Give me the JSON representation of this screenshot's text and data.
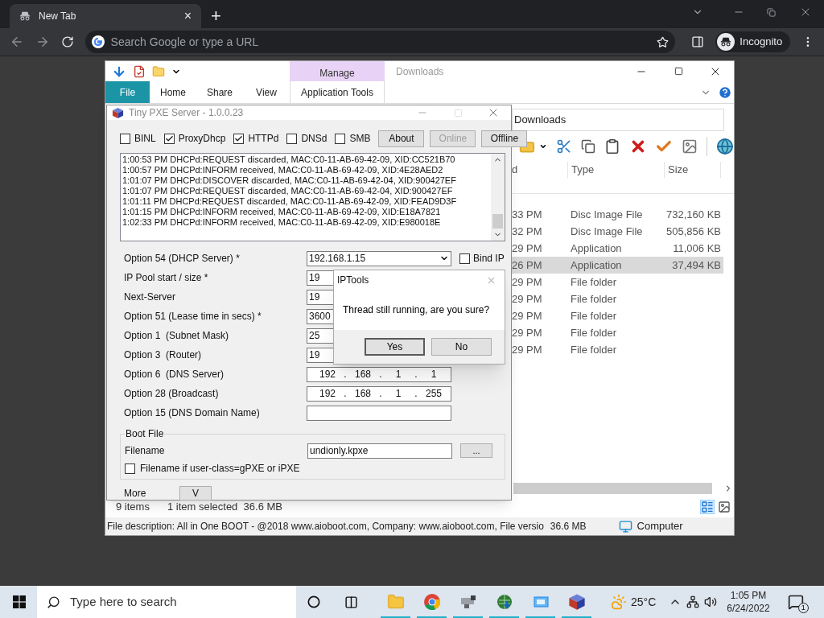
{
  "browser": {
    "tab": {
      "title": "New Tab",
      "close": "×"
    },
    "new_tab": "+",
    "omnibox": {
      "placeholder": "Search Google or type a URL"
    },
    "profile": "Incognito"
  },
  "explorer": {
    "contextual_header": "Manage",
    "title": "Downloads",
    "ribbon_tabs": [
      {
        "label": "File",
        "kind": "file",
        "selected": false
      },
      {
        "label": "Home",
        "kind": "tab",
        "selected": false
      },
      {
        "label": "Share",
        "kind": "tab",
        "selected": false
      },
      {
        "label": "View",
        "kind": "tab",
        "selected": false
      },
      {
        "label": "Application Tools",
        "kind": "contextual",
        "selected": false
      }
    ],
    "address": "Downloads",
    "columns": [
      "d",
      "Type",
      "Size"
    ],
    "rows": [
      {
        "date": "33 PM",
        "type": "Disc Image File",
        "size": "732,160 KB",
        "selected": false
      },
      {
        "date": "32 PM",
        "type": "Disc Image File",
        "size": "505,856 KB",
        "selected": false
      },
      {
        "date": "29 PM",
        "type": "Application",
        "size": "11,006 KB",
        "selected": false
      },
      {
        "date": "26 PM",
        "type": "Application",
        "size": "37,494 KB",
        "selected": true
      },
      {
        "date": "29 PM",
        "type": "File folder",
        "selected": false
      },
      {
        "date": "29 PM",
        "type": "File folder",
        "selected": false
      },
      {
        "date": "29 PM",
        "type": "File folder",
        "selected": false
      },
      {
        "date": "29 PM",
        "type": "File folder",
        "selected": false
      },
      {
        "date": "29 PM",
        "type": "File folder",
        "selected": false
      }
    ],
    "status": {
      "items": "9 items",
      "selection": "1 item selected  36.6 MB"
    },
    "details_bar": {
      "description": "File description: All in One BOOT - @2018 www.aioboot.com, Company: www.aioboot.com, File versio",
      "size": "36.6 MB",
      "location": "Computer"
    }
  },
  "pxe": {
    "title": "Tiny PXE Server - 1.0.0.23",
    "services": [
      {
        "label": "BINL",
        "checked": false
      },
      {
        "label": "ProxyDhcp",
        "checked": true
      },
      {
        "label": "HTTPd",
        "checked": true
      },
      {
        "label": "DNSd",
        "checked": false
      },
      {
        "label": "SMB",
        "checked": false
      }
    ],
    "buttons": [
      {
        "label": "About",
        "disabled": false
      },
      {
        "label": "Online",
        "disabled": true
      },
      {
        "label": "Offline",
        "disabled": false
      }
    ],
    "log": [
      "1:00:53 PM DHCPd:REQUEST discarded, MAC:C0-11-AB-69-42-09, XID:CC521B70",
      "1:00:57 PM DHCPd:INFORM received, MAC:C0-11-AB-69-42-09, XID:4E28AED2",
      "1:01:07 PM DHCPd:DISCOVER discarded, MAC:C0-11-AB-69-42-04, XID:900427EF",
      "1:01:07 PM DHCPd:REQUEST discarded, MAC:C0-11-AB-69-42-04, XID:900427EF",
      "1:01:11 PM DHCPd:REQUEST discarded, MAC:C0-11-AB-69-42-09, XID:FEAD9D3F",
      "1:01:15 PM DHCPd:INFORM received, MAC:C0-11-AB-69-42-09, XID:E18A7821",
      "1:02:33 PM DHCPd:INFORM received, MAC:C0-11-AB-69-42-09, XID:E980018E"
    ],
    "options": [
      {
        "label": "Option 54 (DHCP Server) *",
        "kind": "combo",
        "value": "192.168.1.15"
      },
      {
        "label": "IP Pool start / size *",
        "kind": "text",
        "value": "19"
      },
      {
        "label": "Next-Server",
        "kind": "text",
        "value": "19"
      },
      {
        "label": "Option 51 (Lease time in secs) *",
        "kind": "text",
        "value": "3600"
      },
      {
        "label": "Option 1  (Subnet Mask)",
        "kind": "text",
        "value": "25"
      },
      {
        "label": "Option 3  (Router)",
        "kind": "text",
        "value": "19"
      },
      {
        "label": "Option 6  (DNS Server)",
        "kind": "ip",
        "octets": [
          "192",
          "168",
          "1",
          "1"
        ]
      },
      {
        "label": "Option 28 (Broadcast)",
        "kind": "ip",
        "octets": [
          "192",
          "168",
          "1",
          "255"
        ]
      },
      {
        "label": "Option 15 (DNS Domain Name)",
        "kind": "text"
      }
    ],
    "ip_separator": ".",
    "bind_ip": {
      "label": "Bind IP",
      "checked": false
    },
    "boot_file": {
      "legend": "Boot File",
      "filename_label": "Filename",
      "filename": "undionly.kpxe",
      "browse": "...",
      "user_class": {
        "label": "Filename if user-class=gPXE or iPXE",
        "checked": false
      }
    },
    "more": {
      "label": "More",
      "button": "V"
    }
  },
  "dialog": {
    "title": "IPTools",
    "message": "Thread still running, are you sure?",
    "buttons": [
      {
        "label": "Yes",
        "selected": true
      },
      {
        "label": "No",
        "selected": false
      }
    ]
  },
  "taskbar": {
    "search_placeholder": "Type here to search",
    "apps": [
      {
        "kind": "explorer",
        "running": true
      },
      {
        "kind": "chrome",
        "running": true
      },
      {
        "kind": "tool",
        "running": true
      },
      {
        "kind": "download",
        "running": true
      },
      {
        "kind": "window",
        "running": true
      },
      {
        "kind": "cube",
        "running": true
      }
    ],
    "weather": "25°C",
    "time": "1:05 PM",
    "date": "6/24/2022",
    "notifications": "1"
  }
}
